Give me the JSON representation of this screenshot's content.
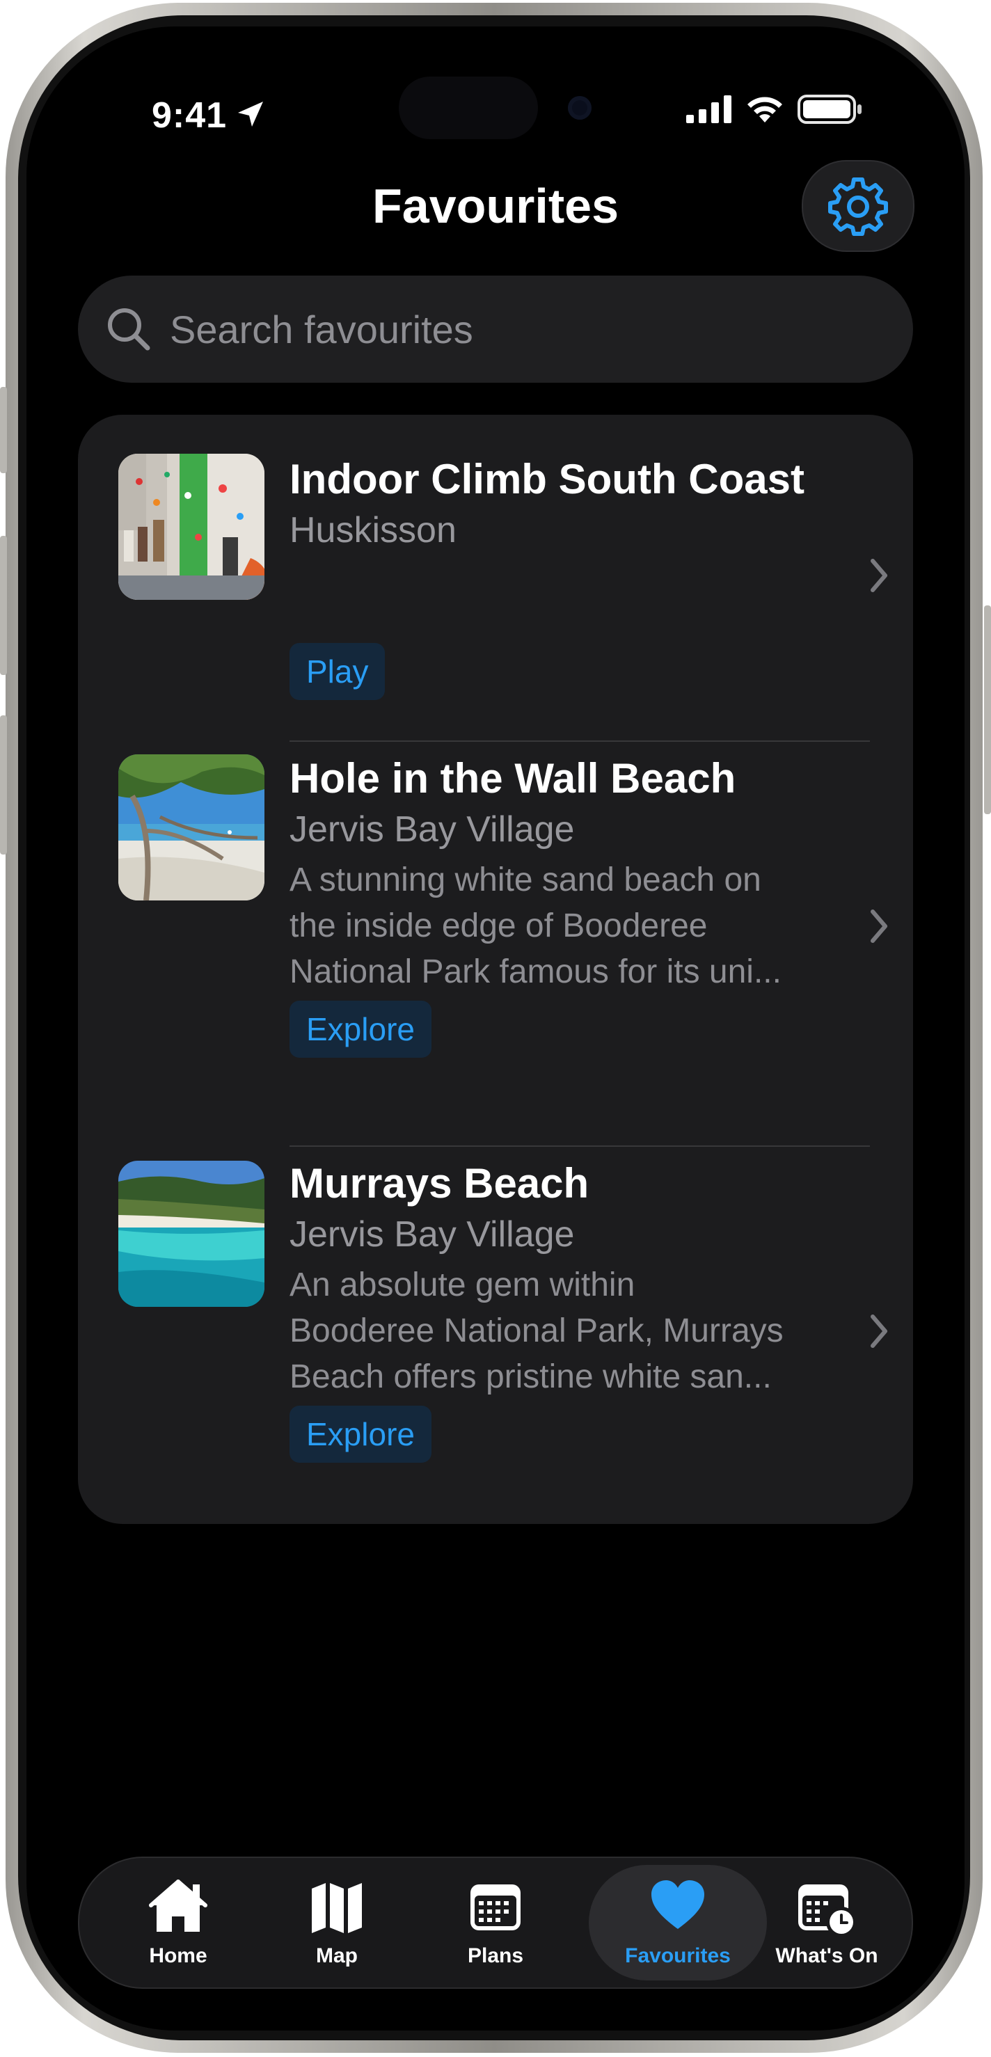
{
  "status": {
    "time": "9:41"
  },
  "header": {
    "title": "Favourites"
  },
  "search": {
    "placeholder": "Search favourites"
  },
  "favourites": [
    {
      "title": "Indoor Climb South Coast",
      "location": "Huskisson",
      "description": [],
      "tag": "Play",
      "thumbnail": "climbing-wall-photo"
    },
    {
      "title": "Hole in the Wall Beach",
      "location": "Jervis Bay Village",
      "description": [
        "A stunning white sand beach on",
        "the inside edge of Booderee",
        "National Park famous for its uni..."
      ],
      "tag": "Explore",
      "thumbnail": "beach-tree-photo"
    },
    {
      "title": "Murrays Beach",
      "location": "Jervis Bay Village",
      "description": [
        "An absolute gem within",
        "Booderee National Park, Murrays",
        "Beach offers pristine white san..."
      ],
      "tag": "Explore",
      "thumbnail": "turquoise-bay-photo"
    }
  ],
  "tabs": [
    {
      "label": "Home",
      "icon": "house-icon",
      "active": false
    },
    {
      "label": "Map",
      "icon": "map-icon",
      "active": false
    },
    {
      "label": "Plans",
      "icon": "calendar-icon",
      "active": false
    },
    {
      "label": "Favourites",
      "icon": "heart-icon",
      "active": true
    },
    {
      "label": "What's On",
      "icon": "calendar-clock-icon",
      "active": false
    }
  ],
  "colors": {
    "accent": "#2a9ef5",
    "card": "#1c1c1e",
    "background": "#000000"
  }
}
